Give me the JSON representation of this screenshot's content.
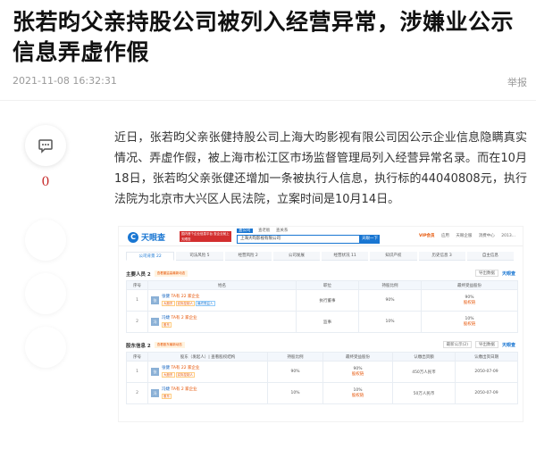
{
  "article": {
    "title": "张若昀父亲持股公司被列入经营异常，涉嫌业公示信息弄虚作假",
    "timestamp": "2021-11-08 16:32:31",
    "report_label": "举报",
    "comment_count": "0",
    "body": "近日，张若昀父亲张健持股公司上海大昀影视有限公司因公示企业信息隐瞒真实情况、弄虚作假，被上海市松江区市场监督管理局列入经营异常名录。而在10月18日，张若昀父亲张健还增加一条被执行人信息，执行标的44040808元，执行法院为北京市大兴区人民法院，立案时间是10月14日。"
  },
  "screenshot": {
    "logo": "天眼查",
    "logo_mark": "C",
    "notice": "国内首个企业信息平台 查企业就上天眼查",
    "search_tabs": [
      "查公司",
      "查老板",
      "查关系"
    ],
    "search_value": "上海大昀影视有限公司",
    "search_button": "天眼一下",
    "header_links": [
      "VIP会员",
      "应用",
      "天眼企服",
      "消费中心",
      "2013..."
    ],
    "tabs": [
      "公司背景 22",
      "司法风险 5",
      "经营风险 2",
      "公司发展",
      "经营状况 11",
      "知识产权",
      "历史信息 3",
      "自主信息"
    ],
    "main_staff": {
      "title": "主要人员 2",
      "tag": "查看董监高最新动态",
      "export": "导出数据",
      "brand": "天眼查",
      "columns": [
        "序号",
        "姓名",
        "职位",
        "持股比例",
        "最终受益股份"
      ],
      "rows": [
        {
          "index": "1",
          "avatar": "张",
          "name": "张健",
          "tags": [
            "大股东",
            "实际控制人",
            "最终受益人"
          ],
          "sub": "TA有 22 家企业",
          "position": "执行董事",
          "ratio": "90%",
          "benefit": "90%",
          "benefit_link": "股权链"
        },
        {
          "index": "2",
          "avatar": "冯",
          "name": "冯婕",
          "tags": [
            "股东"
          ],
          "sub": "TA有 2 家企业",
          "position": "监事",
          "ratio": "10%",
          "benefit": "10%",
          "benefit_link": "股权链"
        }
      ]
    },
    "shareholders": {
      "title": "股东信息 2",
      "tag": "查看股东最新动态",
      "selector": "最新公示(2)",
      "export": "导出数据",
      "brand": "天眼查",
      "columns": [
        "序号",
        "股东（发起人）| 查看股权结构",
        "持股比例",
        "最终受益股份",
        "认缴出资额",
        "认缴出资日期"
      ],
      "rows": [
        {
          "index": "1",
          "avatar": "张",
          "name": "张健",
          "tags": [
            "大股东",
            "实际控制人"
          ],
          "sub": "TA有 22 家企业",
          "ratio": "90%",
          "benefit": "90%",
          "benefit_link": "股权链",
          "amount": "450万人民币",
          "date": "2050-07-09"
        },
        {
          "index": "2",
          "avatar": "冯",
          "name": "冯婕",
          "tags": [
            "股东"
          ],
          "sub": "TA有 2 家企业",
          "ratio": "10%",
          "benefit": "10%",
          "benefit_link": "股权链",
          "amount": "50万人民币",
          "date": "2050-07-09"
        }
      ]
    }
  }
}
